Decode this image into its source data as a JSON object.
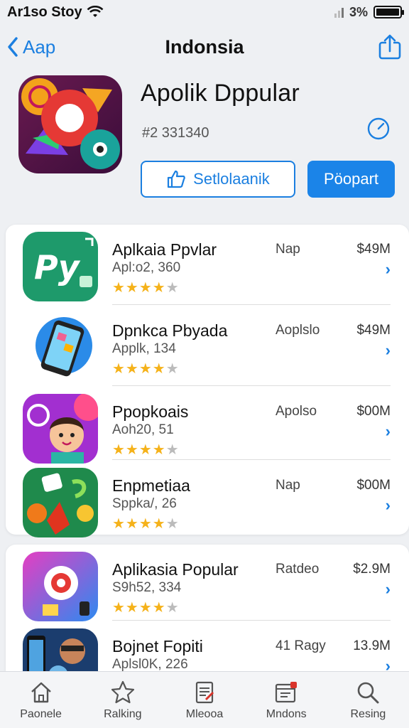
{
  "status": {
    "carrier": "Ar1so Stoy",
    "battery_text": "3%"
  },
  "nav": {
    "back_label": "Aap",
    "title": "Indonsia"
  },
  "header": {
    "app_name": "Apolik Dppular",
    "app_id": "#2 331340",
    "outline_button": "Setlolaanik",
    "primary_button": "Pöopart",
    "accent": "#1b84e8"
  },
  "apps": [
    {
      "title": "Aplkaia Ppvlar",
      "sub": "Apl:o2, 360",
      "category": "Nap",
      "price": "$49M",
      "rating": 4.5
    },
    {
      "title": "Dpnkca Pbyada",
      "sub": "Applk, 134",
      "category": "Aoplslo",
      "price": "$49M",
      "rating": 4.5
    },
    {
      "title": "Ppopkoais",
      "sub": "Aoh20, 51",
      "category": "Apolso",
      "price": "$00M",
      "rating": 4
    },
    {
      "title": "Enpmetiaa",
      "sub": "Sppka/, 26",
      "category": "Nap",
      "price": "$00M",
      "rating": 4
    },
    {
      "title": "Aplikasia Popular",
      "sub": "S9h52, 334",
      "category": "Ratdeo",
      "price": "$2.9M",
      "rating": 4.5
    },
    {
      "title": "Bojnet Fopiti",
      "sub": "Aplsl0K, 226",
      "category": "41 Ragy",
      "price": "13.9M",
      "rating": 0
    }
  ],
  "tabs": [
    {
      "label": "Paonele",
      "icon": "home-icon"
    },
    {
      "label": "Ralking",
      "icon": "star-icon"
    },
    {
      "label": "Mleooa",
      "icon": "document-icon"
    },
    {
      "label": "Mndons",
      "icon": "calendar-icon"
    },
    {
      "label": "Resing",
      "icon": "search-icon"
    }
  ]
}
